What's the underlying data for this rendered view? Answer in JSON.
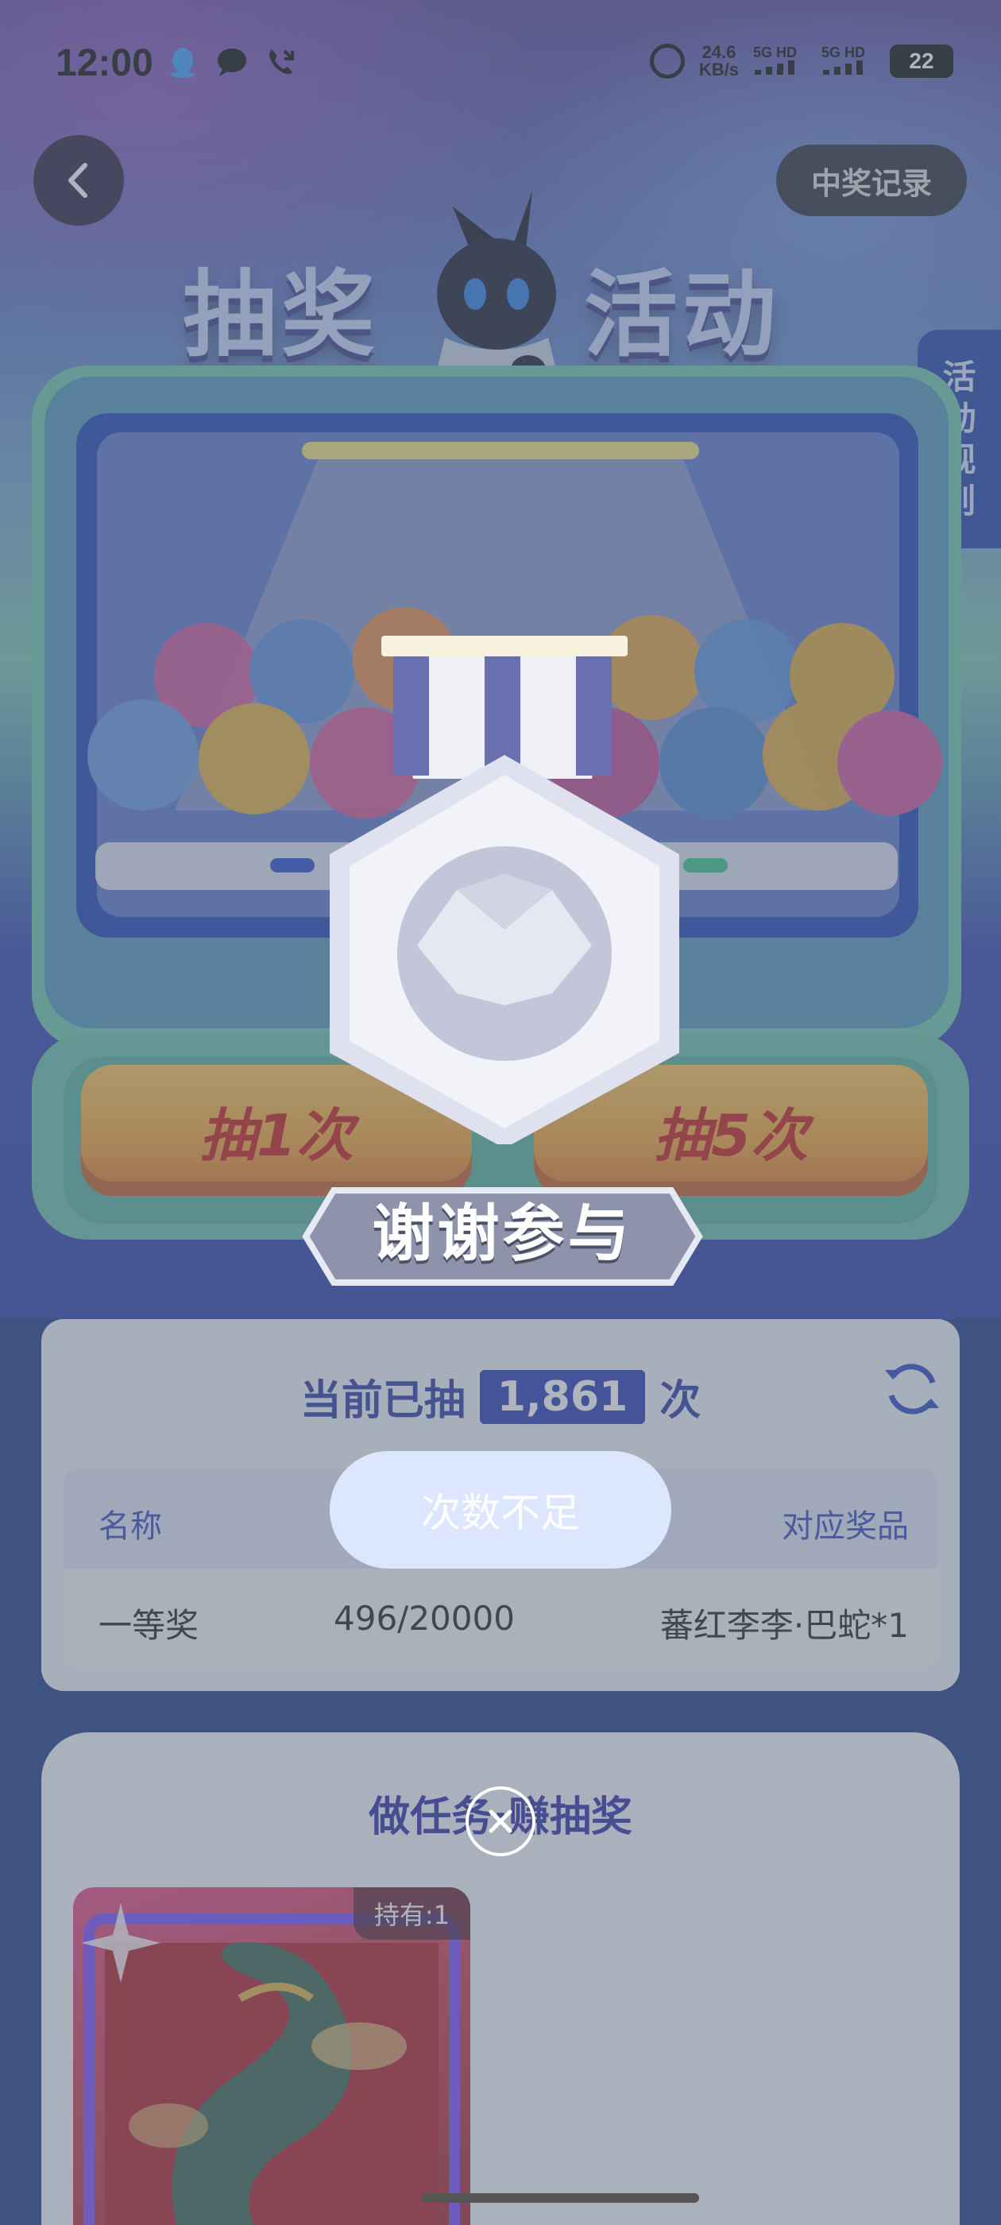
{
  "status_bar": {
    "time": "12:00",
    "net_speed_value": "24.6",
    "net_speed_unit": "KB/s",
    "network_1": "5G HD",
    "network_2": "5G HD",
    "battery": "22",
    "icons": [
      "qq-icon",
      "chat-icon",
      "missed-call-icon",
      "alarm-icon",
      "signal-icon",
      "battery-icon"
    ]
  },
  "header": {
    "title_part1": "抽奖",
    "title_part2": "活动",
    "record_button": "中奖记录",
    "rules_tab": "活动规则"
  },
  "machine": {
    "draw_once_button": "抽1次",
    "draw_five_button": "抽5次"
  },
  "result_popup": {
    "result_text": "谢谢参与",
    "toast": "次数不足"
  },
  "stats": {
    "label_prefix": "当前已抽",
    "count": "1,861",
    "label_suffix": "次"
  },
  "prize_table": {
    "columns": [
      "名称",
      "",
      "对应奖品"
    ],
    "rows": [
      {
        "name": "一等奖",
        "progress": "496/20000",
        "prize": "蕃红李李·巴蛇*1"
      }
    ]
  },
  "tasks": {
    "title": "做任务·赚抽奖",
    "card_hold": "持有:1"
  },
  "colors": {
    "accent_blue": "#2a3db8",
    "button_orange": "#f2a43a",
    "button_text_red": "#c81e1e",
    "panel_bg": "#eef2fb"
  }
}
